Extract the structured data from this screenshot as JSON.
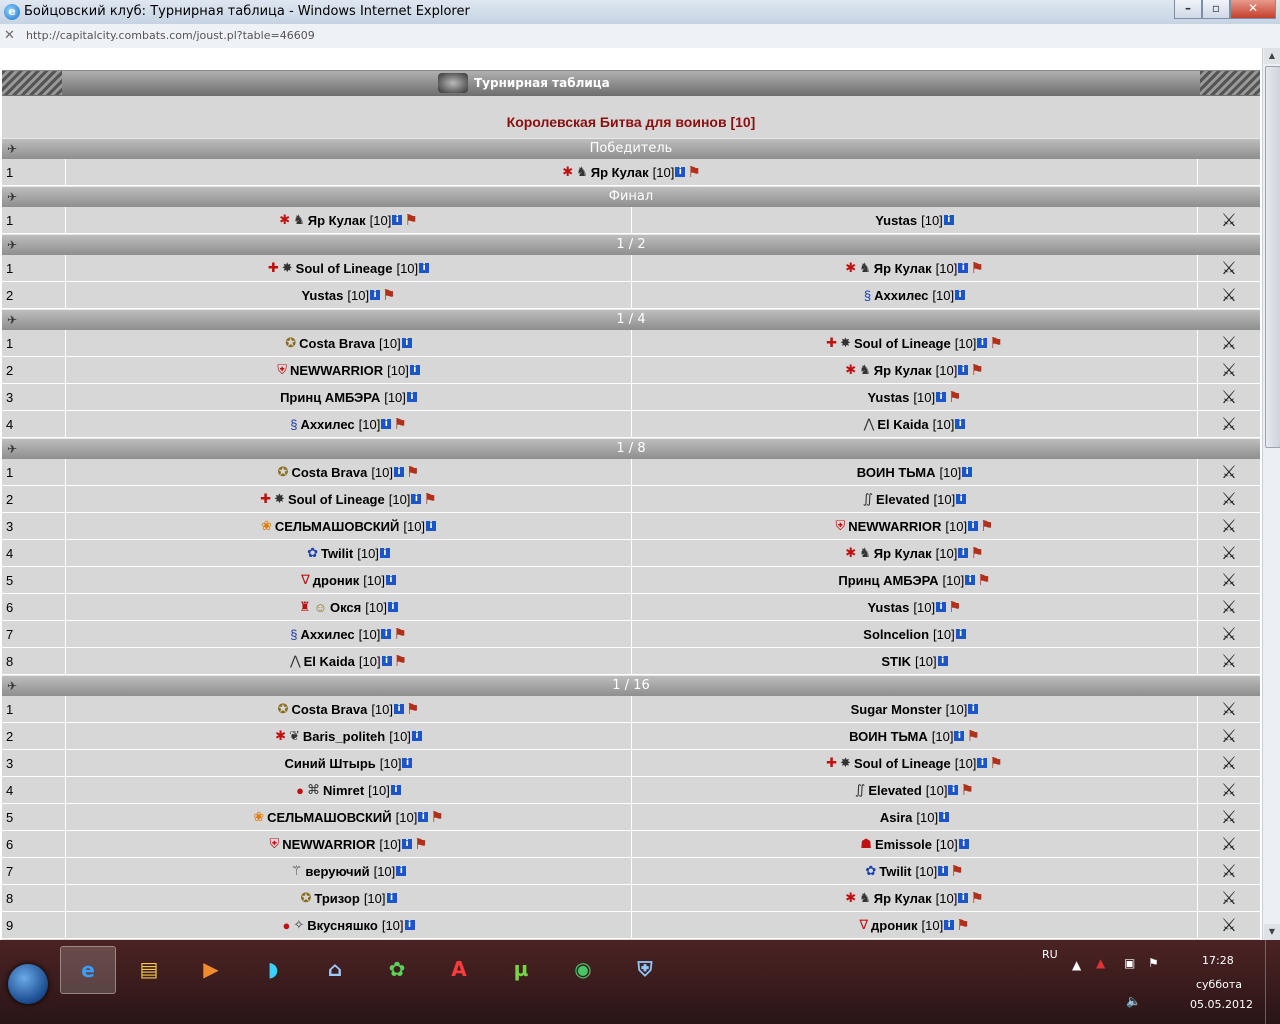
{
  "window": {
    "title": "Бойцовский клуб: Турнирная таблица - Windows Internet Explorer"
  },
  "address": {
    "url": "http://capitalcity.combats.com/joust.pl?table=46609"
  },
  "page": {
    "header_title": "Турнирная таблица",
    "tournament_title": "Королевская Битва для воинов [10]"
  },
  "sections": [
    {
      "label": "Победитель",
      "winner": true,
      "rows": [
        {
          "n": "1",
          "left": {
            "name": "Яр Кулак",
            "level": "[10]",
            "icons": [
              "ladybug-icon",
              "wolf-icon"
            ],
            "flag": true
          }
        }
      ]
    },
    {
      "label": "Финал",
      "rows": [
        {
          "n": "1",
          "left": {
            "name": "Яр Кулак",
            "level": "[10]",
            "icons": [
              "ladybug-icon",
              "wolf-icon"
            ],
            "flag": true
          },
          "right": {
            "name": "Yustas",
            "level": "[10]",
            "icons": [],
            "flag": false
          }
        }
      ]
    },
    {
      "label": "1 / 2",
      "rows": [
        {
          "n": "1",
          "left": {
            "name": "Soul of Lineage",
            "level": "[10]",
            "icons": [
              "red-cross-icon",
              "dragon-icon"
            ],
            "flag": false
          },
          "right": {
            "name": "Яр Кулак",
            "level": "[10]",
            "icons": [
              "ladybug-icon",
              "wolf-icon"
            ],
            "flag": true
          }
        },
        {
          "n": "2",
          "left": {
            "name": "Yustas",
            "level": "[10]",
            "icons": [],
            "flag": true
          },
          "right": {
            "name": "Аххилес",
            "level": "[10]",
            "icons": [
              "blue-rune-icon"
            ],
            "flag": false
          }
        }
      ]
    },
    {
      "label": "1 / 4",
      "rows": [
        {
          "n": "1",
          "left": {
            "name": "Costa Brava",
            "level": "[10]",
            "icons": [
              "shield-emblem-icon"
            ],
            "flag": false
          },
          "right": {
            "name": "Soul of Lineage",
            "level": "[10]",
            "icons": [
              "red-cross-icon",
              "dragon-icon"
            ],
            "flag": true
          }
        },
        {
          "n": "2",
          "left": {
            "name": "NEWWARRIOR",
            "level": "[10]",
            "icons": [
              "red-shield-icon"
            ],
            "flag": false
          },
          "right": {
            "name": "Яр Кулак",
            "level": "[10]",
            "icons": [
              "ladybug-icon",
              "wolf-icon"
            ],
            "flag": true
          }
        },
        {
          "n": "3",
          "left": {
            "name": "Принц АМБЭРА",
            "level": "[10]",
            "icons": [],
            "flag": false
          },
          "right": {
            "name": "Yustas",
            "level": "[10]",
            "icons": [],
            "flag": true
          }
        },
        {
          "n": "4",
          "left": {
            "name": "Аххилес",
            "level": "[10]",
            "icons": [
              "blue-rune-icon"
            ],
            "flag": true
          },
          "right": {
            "name": "El Kaida",
            "level": "[10]",
            "icons": [
              "bat-icon"
            ],
            "flag": false
          }
        }
      ]
    },
    {
      "label": "1 / 8",
      "rows": [
        {
          "n": "1",
          "left": {
            "name": "Costa Brava",
            "level": "[10]",
            "icons": [
              "shield-emblem-icon"
            ],
            "flag": true
          },
          "right": {
            "name": "ВОИН ТЬМА",
            "level": "[10]",
            "icons": [],
            "flag": false
          }
        },
        {
          "n": "2",
          "left": {
            "name": "Soul of Lineage",
            "level": "[10]",
            "icons": [
              "red-cross-icon",
              "dragon-icon"
            ],
            "flag": true
          },
          "right": {
            "name": "Elevated",
            "level": "[10]",
            "icons": [
              "monogram-icon"
            ],
            "flag": false
          }
        },
        {
          "n": "3",
          "left": {
            "name": "СЕЛЬМАШОВСКИЙ",
            "level": "[10]",
            "icons": [
              "fire-bird-icon"
            ],
            "flag": false
          },
          "right": {
            "name": "NEWWARRIOR",
            "level": "[10]",
            "icons": [
              "red-shield-icon"
            ],
            "flag": true
          }
        },
        {
          "n": "4",
          "left": {
            "name": "Twilit",
            "level": "[10]",
            "icons": [
              "blue-paws-icon"
            ],
            "flag": false
          },
          "right": {
            "name": "Яр Кулак",
            "level": "[10]",
            "icons": [
              "ladybug-icon",
              "wolf-icon"
            ],
            "flag": true
          }
        },
        {
          "n": "5",
          "left": {
            "name": "дроник",
            "level": "[10]",
            "icons": [
              "v-badge-icon"
            ],
            "flag": false
          },
          "right": {
            "name": "Принц АМБЭРА",
            "level": "[10]",
            "icons": [],
            "flag": true
          }
        },
        {
          "n": "6",
          "left": {
            "name": "Окся",
            "level": "[10]",
            "icons": [
              "knight-icon",
              "smiley-icon"
            ],
            "flag": false
          },
          "right": {
            "name": "Yustas",
            "level": "[10]",
            "icons": [],
            "flag": true
          }
        },
        {
          "n": "7",
          "left": {
            "name": "Аххилес",
            "level": "[10]",
            "icons": [
              "blue-rune-icon"
            ],
            "flag": true
          },
          "right": {
            "name": "Solncelion",
            "level": "[10]",
            "icons": [],
            "flag": false
          }
        },
        {
          "n": "8",
          "left": {
            "name": "El Kaida",
            "level": "[10]",
            "icons": [
              "bat-icon"
            ],
            "flag": true
          },
          "right": {
            "name": "STIK",
            "level": "[10]",
            "icons": [],
            "flag": false
          }
        }
      ]
    },
    {
      "label": "1 / 16",
      "rows": [
        {
          "n": "1",
          "left": {
            "name": "Costa Brava",
            "level": "[10]",
            "icons": [
              "shield-emblem-icon"
            ],
            "flag": true
          },
          "right": {
            "name": "Sugar Monster",
            "level": "[10]",
            "icons": [],
            "flag": false
          }
        },
        {
          "n": "2",
          "left": {
            "name": "Baris_politeh",
            "level": "[10]",
            "icons": [
              "ladybug-icon",
              "green-creature-icon"
            ],
            "flag": false
          },
          "right": {
            "name": "ВОИН ТЬМА",
            "level": "[10]",
            "icons": [],
            "flag": true
          }
        },
        {
          "n": "3",
          "left": {
            "name": "Синий Штырь",
            "level": "[10]",
            "icons": [],
            "flag": false
          },
          "right": {
            "name": "Soul of Lineage",
            "level": "[10]",
            "icons": [
              "red-cross-icon",
              "dragon-icon"
            ],
            "flag": true
          }
        },
        {
          "n": "4",
          "left": {
            "name": "Nimret",
            "level": "[10]",
            "icons": [
              "red-dot-icon",
              "claw-icon"
            ],
            "flag": false
          },
          "right": {
            "name": "Elevated",
            "level": "[10]",
            "icons": [
              "monogram-icon"
            ],
            "flag": true
          }
        },
        {
          "n": "5",
          "left": {
            "name": "СЕЛЬМАШОВСКИЙ",
            "level": "[10]",
            "icons": [
              "fire-bird-icon"
            ],
            "flag": true
          },
          "right": {
            "name": "Asira",
            "level": "[10]",
            "icons": [],
            "flag": false
          }
        },
        {
          "n": "6",
          "left": {
            "name": "NEWWARRIOR",
            "level": "[10]",
            "icons": [
              "red-shield-icon"
            ],
            "flag": true
          },
          "right": {
            "name": "Emissole",
            "level": "[10]",
            "icons": [
              "dark-beast-icon"
            ],
            "flag": false
          }
        },
        {
          "n": "7",
          "left": {
            "name": "веруючий",
            "level": "[10]",
            "icons": [
              "scythe-icon"
            ],
            "flag": false
          },
          "right": {
            "name": "Twilit",
            "level": "[10]",
            "icons": [
              "blue-paws-icon"
            ],
            "flag": true
          }
        },
        {
          "n": "8",
          "left": {
            "name": "Тризор",
            "level": "[10]",
            "icons": [
              "shield-emblem-icon"
            ],
            "flag": false
          },
          "right": {
            "name": "Яр Кулак",
            "level": "[10]",
            "icons": [
              "ladybug-icon",
              "wolf-icon"
            ],
            "flag": true
          }
        },
        {
          "n": "9",
          "left": {
            "name": "Вкусняшко",
            "level": "[10]",
            "icons": [
              "red-dot-icon",
              "teal-emblem-icon"
            ],
            "flag": false
          },
          "right": {
            "name": "дроник",
            "level": "[10]",
            "icons": [
              "v-badge-icon"
            ],
            "flag": true
          }
        }
      ]
    }
  ],
  "taskbar": {
    "apps": [
      "ie-icon",
      "folder-icon",
      "media-player-icon",
      "headphones-icon",
      "network-icon",
      "icq-icon",
      "acrobat-icon",
      "utorrent-icon",
      "radio-icon",
      "security-icon"
    ],
    "lang": "RU",
    "time": "17:28",
    "day": "суббота",
    "date": "05.05.2012"
  }
}
